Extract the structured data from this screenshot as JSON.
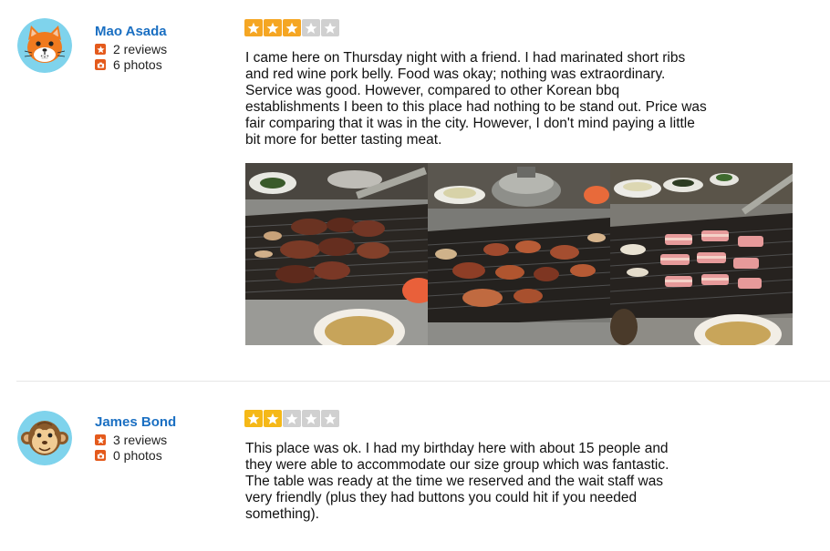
{
  "colors": {
    "star_filled": "#f5b817",
    "star_filled_alt": "#f5a623",
    "star_empty": "#d0d0d0",
    "name_link": "#1a6fc2",
    "stat_icon": "#e45a1c",
    "avatar_bg": "#7fd3ec"
  },
  "reviews": [
    {
      "user": {
        "name": "Mao Asada",
        "avatar_icon": "orange-cat-avatar",
        "reviews_count": "2 reviews",
        "photos_count": "6 photos"
      },
      "rating": 3,
      "rating_max": 5,
      "text": "I came here on Thursday night with a friend. I had marinated short ribs and red wine pork belly. Food was okay; nothing was extraordinary. Service was good. However, compared to other Korean bbq establishments I been to this place had nothing to be stand out. Price was fair comparing that it was in the city. However, I don't mind paying a little bit more for better tasting meat.",
      "photos": [
        {
          "icon": "grilled-short-ribs-photo"
        },
        {
          "icon": "grilled-pork-belly-photo"
        },
        {
          "icon": "raw-pork-belly-grill-photo"
        }
      ]
    },
    {
      "user": {
        "name": "James Bond",
        "avatar_icon": "monkey-avatar",
        "reviews_count": "3 reviews",
        "photos_count": "0 photos"
      },
      "rating": 2,
      "rating_max": 5,
      "text": "This place was ok. I had my birthday here with about 15 people and they were able to accommodate our size group which was fantastic. The table was ready at the time we reserved and the wait staff was very friendly (plus they had buttons you could hit if you needed something).",
      "photos": []
    }
  ]
}
